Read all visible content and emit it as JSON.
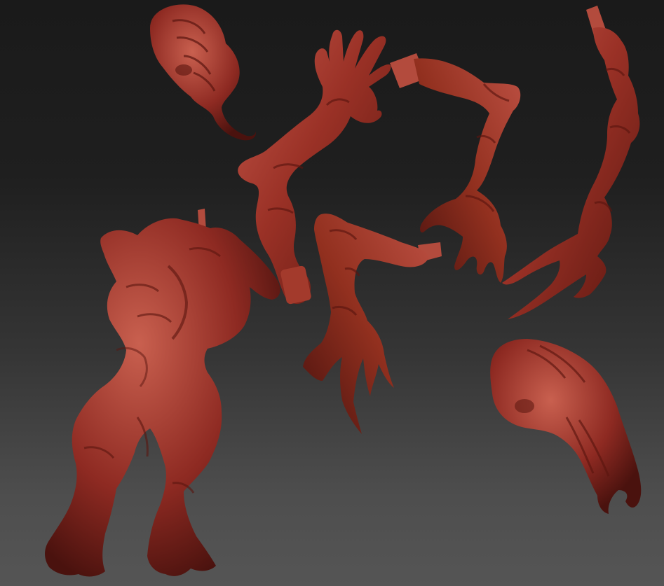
{
  "scene": {
    "kind": "3d-sculpt-render",
    "background_top": "#1a1a1a",
    "background_bottom": "#555555",
    "material_base": "#8e2a22",
    "material_highlight": "#c4574a",
    "material_shadow": "#4a120e",
    "parts": [
      "head-upper",
      "arm-open-hand",
      "arm-clawed-center",
      "arm-clawed-right",
      "forearm-talon",
      "torso-legs",
      "head-lower"
    ]
  }
}
